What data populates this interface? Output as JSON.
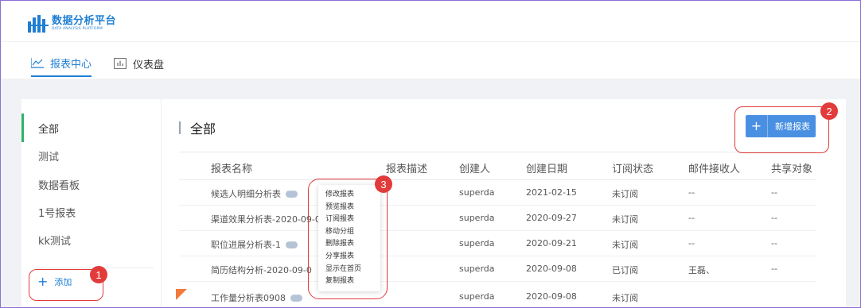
{
  "app": {
    "logo_cn": "数据分析平台",
    "logo_en": "DATA ANALYSIS PLATFORM",
    "brand_color": "#1f7ed4"
  },
  "tabs": [
    {
      "label": "报表中心",
      "icon": "line-chart-icon",
      "active": true
    },
    {
      "label": "仪表盘",
      "icon": "bar-chart-icon",
      "active": false
    }
  ],
  "sidebar": {
    "items": [
      {
        "label": "全部",
        "active": true
      },
      {
        "label": "测试",
        "active": false
      },
      {
        "label": "数据看板",
        "active": false
      },
      {
        "label": "1号报表",
        "active": false
      },
      {
        "label": "kk测试",
        "active": false
      }
    ],
    "add_label": "添加"
  },
  "main": {
    "title": "全部",
    "new_button_label": "新增报表"
  },
  "table": {
    "headers": [
      "报表名称",
      "报表描述",
      "创建人",
      "创建日期",
      "订阅状态",
      "邮件接收人",
      "共享对象"
    ],
    "rows": [
      {
        "name": "候选人明细分析表",
        "desc": "",
        "creator": "superda",
        "date": "2021-02-15",
        "status": "未订阅",
        "recipient": "--",
        "share": "--"
      },
      {
        "name": "渠道效果分析表-2020-09-0",
        "desc": "",
        "creator": "superda",
        "date": "2020-09-27",
        "status": "未订阅",
        "recipient": "--",
        "share": "--"
      },
      {
        "name": "职位进展分析表-1",
        "desc": "",
        "creator": "superda",
        "date": "2020-09-21",
        "status": "未订阅",
        "recipient": "--",
        "share": "--"
      },
      {
        "name": "简历结构分析-2020-09-0",
        "desc": "",
        "creator": "superda",
        "date": "2020-09-08",
        "status": "已订阅",
        "recipient": "王磊、",
        "share": "--"
      },
      {
        "name": "工作量分析表0908",
        "desc": "",
        "creator": "superda",
        "date": "2020-09-08",
        "status": "未订阅",
        "recipient": "--",
        "share": "--"
      }
    ]
  },
  "context_menu": {
    "items": [
      "修改报表",
      "预览报表",
      "订阅报表",
      "移动分组",
      "删除报表",
      "分享报表",
      "显示在首页",
      "复制报表"
    ]
  },
  "annotations": [
    "1",
    "2",
    "3"
  ],
  "colors": {
    "annotation": "#e23b3b",
    "primary_button": "#4a90e2",
    "sidebar_active": "#2fb36a"
  }
}
